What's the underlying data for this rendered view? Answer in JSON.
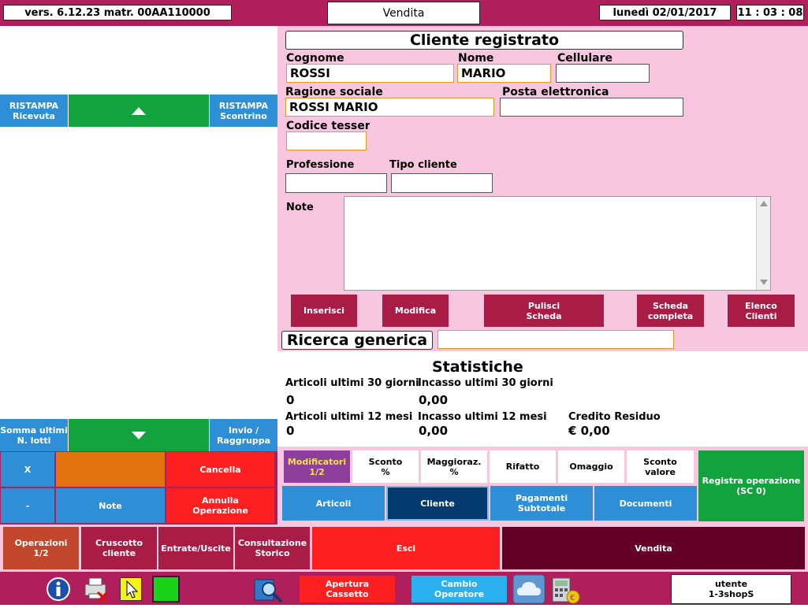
{
  "topbar": {
    "version": "vers. 6.12.23 matr. 00AA110000",
    "mode": "Vendita",
    "date": "lunedì 02/01/2017",
    "time": "11 : 03 : 08"
  },
  "left": {
    "reprint_receipt": "RISTAMPA\nRicevuta",
    "reprint_slip": "RISTAMPA\nScontrino",
    "sum_lots": "Somma ultimi\nN. lotti",
    "send_group": "Invio /\nRaggruppa",
    "x": "X",
    "minus": "-",
    "cancel": "Cancella",
    "notes": "Note",
    "annulla": "Annulla\nOperazione"
  },
  "client": {
    "title": "Cliente registrato",
    "cognome_label": "Cognome",
    "cognome": "ROSSI",
    "nome_label": "Nome",
    "nome": "MARIO",
    "cellulare_label": "Cellulare",
    "cellulare": "",
    "ragione_label": "Ragione sociale",
    "ragione": "ROSSI MARIO",
    "email_label": "Posta elettronica",
    "email": "",
    "tessera_label": "Codice tessera",
    "tessera": "",
    "professione_label": "Professione",
    "professione": "",
    "tipo_label": "Tipo cliente",
    "tipo": "",
    "note_label": "Note",
    "note": "",
    "btn_insert": "Inserisci",
    "btn_modify": "Modifica",
    "btn_clear": "Pulisci\nScheda",
    "btn_full": "Scheda\ncompleta",
    "btn_list": "Elenco\nClienti",
    "search_label": "Ricerca generica",
    "search_value": ""
  },
  "stats": {
    "title": "Statistiche",
    "art30_label": "Articoli ultimi 30 giorni",
    "art30": "0",
    "inc30_label": "Incasso ultimi 30 giorni",
    "inc30": "0,00",
    "art12_label": "Articoli ultimi 12 mesi",
    "art12": "0",
    "inc12_label": "Incasso ultimi 12 mesi",
    "inc12": "0,00",
    "credit_label": "Credito Residuo",
    "credit": "€ 0,00"
  },
  "modifiers": {
    "modificatori": "Modificatori\n1/2",
    "sconto_pct": "Sconto\n%",
    "maggioraz": "Maggioraz.\n%",
    "rifatto": "Rifatto",
    "omaggio": "Omaggio",
    "sconto_valore": "Sconto\nvalore",
    "registra": "Registra operazione\n(SC 0)"
  },
  "tabs": {
    "articoli": "Articoli",
    "cliente": "Cliente",
    "pagamenti": "Pagamenti\nSubtotale",
    "documenti": "Documenti"
  },
  "bottom": {
    "operazioni": "Operazioni\n1/2",
    "cruscotto": "Cruscotto\ncliente",
    "entrate": "Entrate/Uscite",
    "consultazione": "Consultazione\nStorico",
    "esci": "Esci",
    "vendita": "Vendita"
  },
  "taskbar": {
    "apertura": "Apertura\nCassetto",
    "cambio": "Cambio\nOperatore",
    "utente": "utente\n1-3shopS"
  },
  "colors": {
    "frame": "#b01e5c",
    "pink": "#f8c6df",
    "green": "#12a23e",
    "blue": "#2e8fd6",
    "red": "#fe2020",
    "maroon": "#a81c46",
    "dark_maroon": "#640025",
    "orange": "#e0730d",
    "navy": "#053a6e"
  }
}
